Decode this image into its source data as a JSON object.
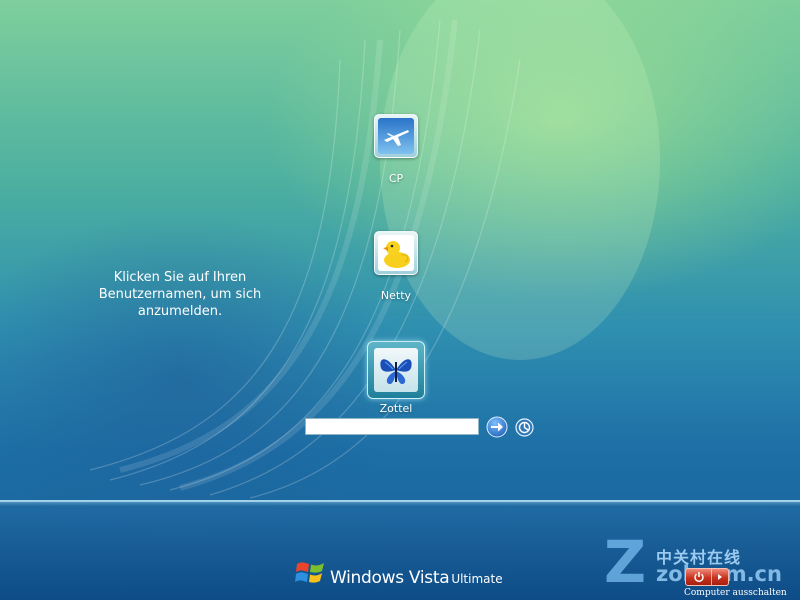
{
  "screen": "windows-vista-login",
  "colors": {
    "sky_top": "#7fcf9c",
    "sky_bottom": "#1a5f96",
    "shutdown_red": "#c8321e",
    "go_blue": "#1e6fc9"
  },
  "instruction": {
    "line1": "Klicken Sie auf Ihren",
    "line2": "Benutzernamen, um sich",
    "line3": "anzumelden."
  },
  "users": [
    {
      "name": "CP",
      "picture": "airplane-icon"
    },
    {
      "name": "Netty",
      "picture": "rubber-duck-icon"
    },
    {
      "name": "Zottel",
      "picture": "butterfly-icon",
      "selected": true
    }
  ],
  "password_field": {
    "value": ""
  },
  "buttons": {
    "go": "arrow-right-icon",
    "accessibility": "ease-of-access-icon"
  },
  "branding": {
    "word": "Windows Vista",
    "edition": "Ultimate",
    "logo": "windows-flag-icon"
  },
  "watermark": {
    "letter": "Z",
    "cn": "中关村在线",
    "url": "zol.com.cn"
  },
  "shutdown": {
    "label": "Computer ausschalten",
    "icon": "power-icon"
  }
}
